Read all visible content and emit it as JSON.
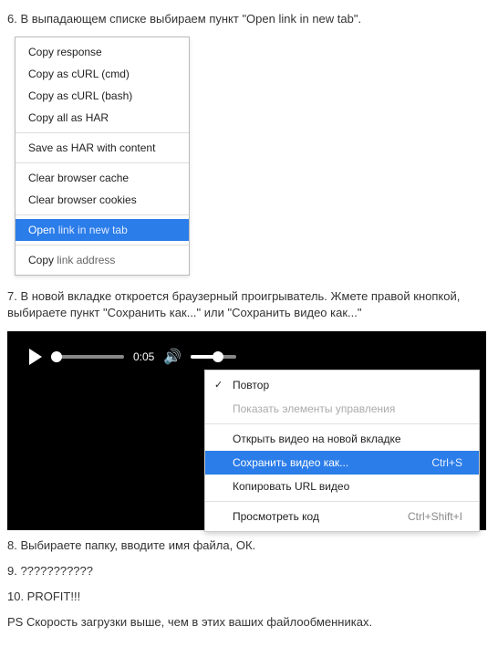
{
  "steps": {
    "s6": "6. В выпадающем списке выбираем пункт \"Open link in new tab\".",
    "s7": "7. В новой вкладке откроется браузерный проигрыватель. Жмете правой кнопкой, выбираете пункт \"Сохранить как...\" или \"Сохранить видео как...\"",
    "s8": "8. Выбираете папку, вводите имя файла, ОК.",
    "s9": "9. ???????????",
    "s10": "10. PROFIT!!!",
    "ps": "PS Скорость загрузки выше, чем в этих ваших файлообменниках."
  },
  "menu1": {
    "g1": [
      "Copy response",
      "Copy as cURL (cmd)",
      "Copy as cURL (bash)",
      "Copy all as HAR"
    ],
    "g2": [
      "Save as HAR with content"
    ],
    "g3": [
      "Clear browser cache",
      "Clear browser cookies"
    ],
    "g4_sel_prefix": "Open ",
    "g4_sel_hl": "link in new tab",
    "g5_prefix": "Copy ",
    "g5_rest": "link address"
  },
  "video": {
    "time": "0:05"
  },
  "menu2": {
    "loop": "Повтор",
    "show_controls": "Показать элементы управления",
    "open_new_tab": "Открыть видео на новой вкладке",
    "save_as": "Сохранить видео как...",
    "save_as_shortcut": "Ctrl+S",
    "copy_url": "Копировать URL видео",
    "inspect": "Просмотреть код",
    "inspect_shortcut": "Ctrl+Shift+I"
  }
}
